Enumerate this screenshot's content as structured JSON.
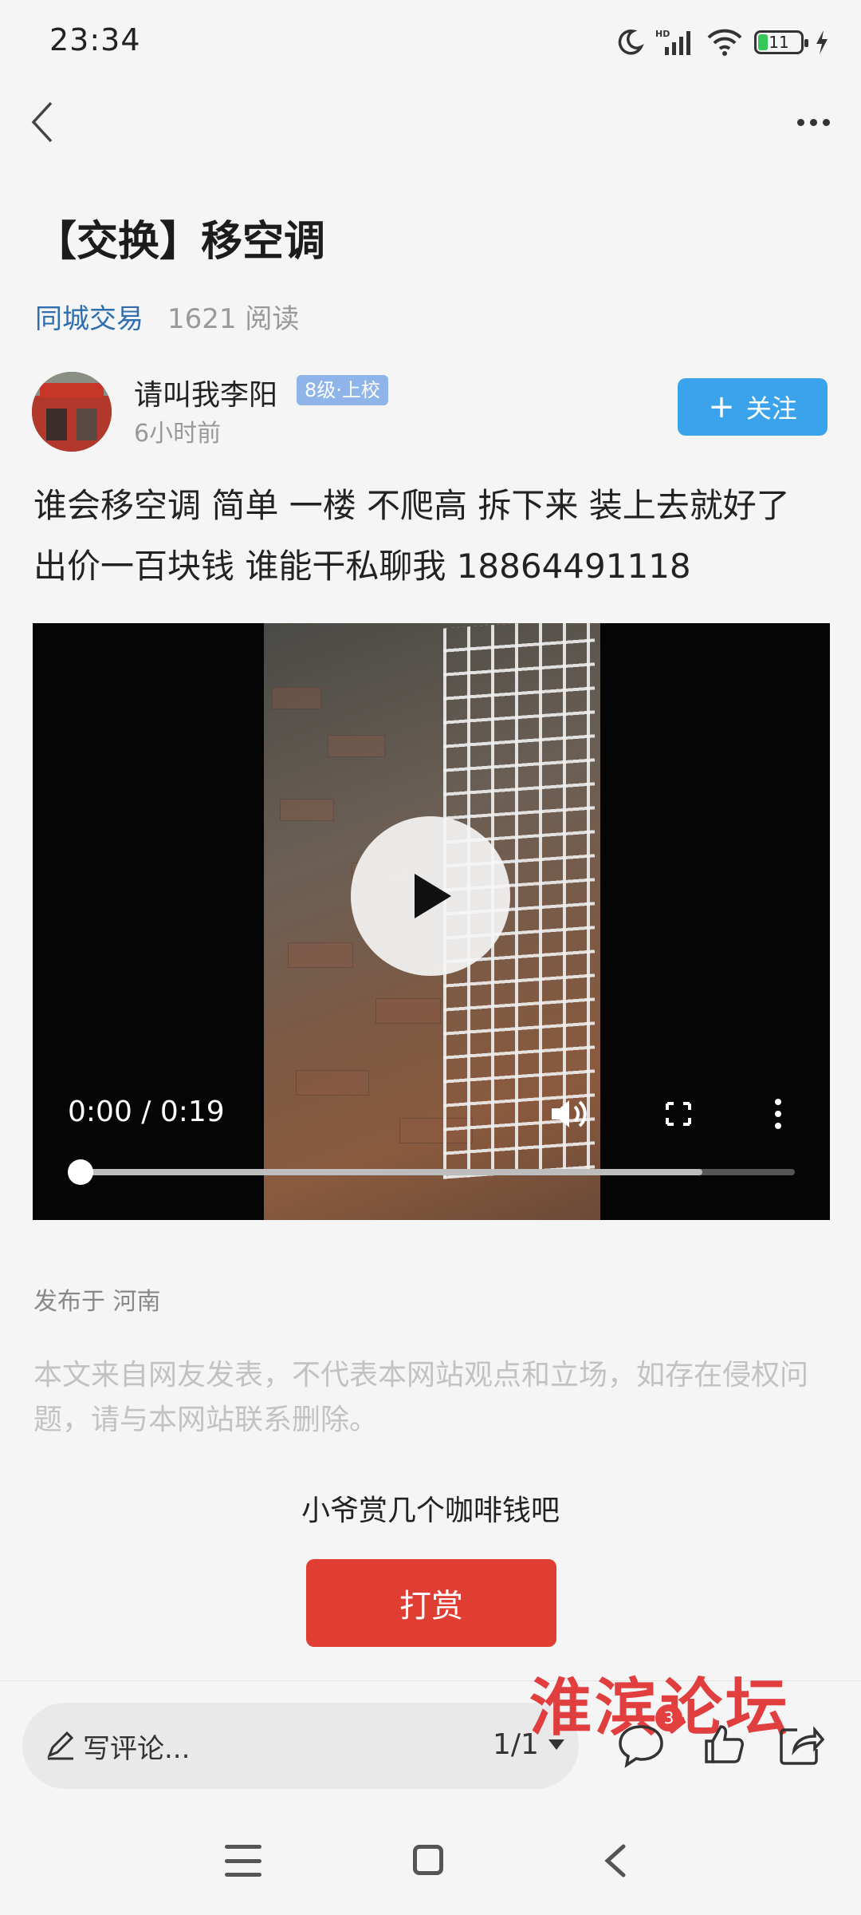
{
  "status_bar": {
    "time": "23:34",
    "battery": "11",
    "hd_label": "HD"
  },
  "header": {
    "back_icon": "chevron-left-icon",
    "more_icon": "more-horizontal-icon"
  },
  "post": {
    "title": "【交换】移空调",
    "category": "同城交易",
    "read_count": "1621 阅读",
    "author": {
      "name": "请叫我李阳",
      "badge": "8级·上校",
      "time": "6小时前",
      "avatar_icon": "user-avatar"
    },
    "follow_label": "关注",
    "body": "谁会移空调 简单 一楼 不爬高 拆下来 装上去就好了 出价一百块钱 谁能干私聊我 18864491118",
    "video": {
      "time": "0:00 / 0:19",
      "buffered": 0.87,
      "played": 0.0
    },
    "location": "发布于 河南",
    "disclaimer": "本文来自网友发表，不代表本网站观点和立场，如存在侵权问题，请与本网站联系删除。",
    "reward_prompt": "小爷赏几个咖啡钱吧",
    "reward_button": "打赏"
  },
  "bottom_bar": {
    "comment_placeholder": "写评论...",
    "page_indicator": "1/1",
    "comment_count": "3",
    "watermark": "淮滨论坛"
  },
  "colors": {
    "accent": "#3aa3ec",
    "reward": "#e03d33",
    "link": "#2f6fb0",
    "badge": "#8fb4ea"
  }
}
